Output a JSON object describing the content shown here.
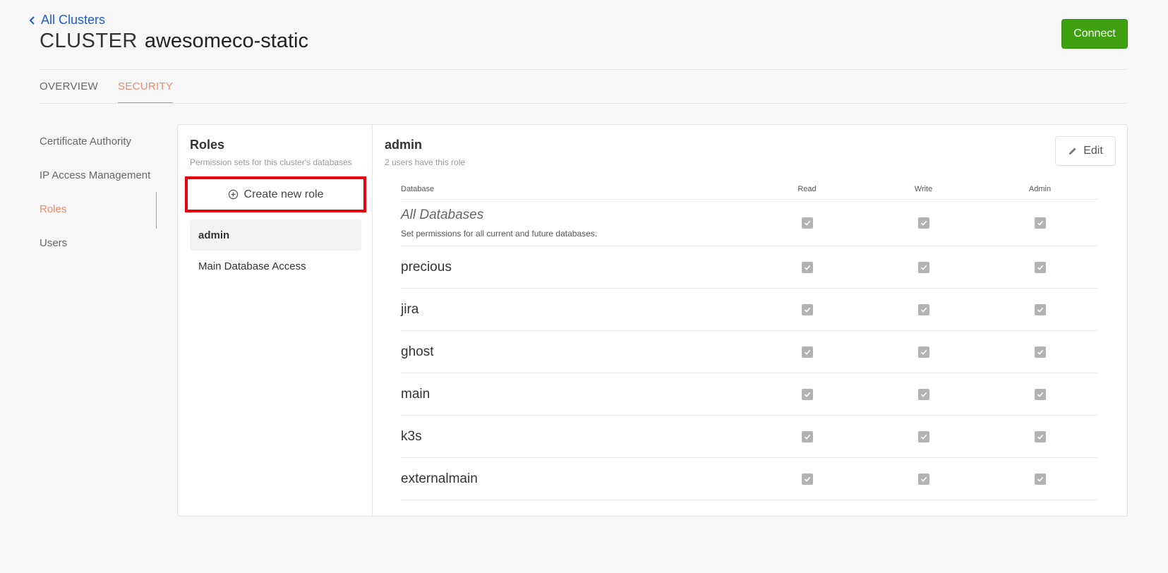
{
  "header": {
    "back_label": "All Clusters",
    "cluster_prefix": "CLUSTER",
    "cluster_name": "awesomeco-static",
    "connect_label": "Connect"
  },
  "tabs": [
    {
      "label": "OVERVIEW",
      "active": false
    },
    {
      "label": "SECURITY",
      "active": true
    }
  ],
  "side_nav": [
    {
      "label": "Certificate Authority",
      "active": false
    },
    {
      "label": "IP Access Management",
      "active": false
    },
    {
      "label": "Roles",
      "active": true
    },
    {
      "label": "Users",
      "active": false
    }
  ],
  "roles_panel": {
    "title": "Roles",
    "subtitle": "Permission sets for this cluster's databases",
    "create_label": "Create new role",
    "roles": [
      {
        "label": "admin",
        "active": true
      },
      {
        "label": "Main Database Access",
        "active": false
      }
    ]
  },
  "detail": {
    "role_name": "admin",
    "user_count_text": "2 users have this role",
    "edit_label": "Edit",
    "columns": [
      "Database",
      "Read",
      "Write",
      "Admin"
    ],
    "rows": [
      {
        "name": "All Databases",
        "description": "Set permissions for all current and future databases.",
        "read": true,
        "write": true,
        "admin": true
      },
      {
        "name": "precious",
        "read": true,
        "write": true,
        "admin": true
      },
      {
        "name": "jira",
        "read": true,
        "write": true,
        "admin": true
      },
      {
        "name": "ghost",
        "read": true,
        "write": true,
        "admin": true
      },
      {
        "name": "main",
        "read": true,
        "write": true,
        "admin": true
      },
      {
        "name": "k3s",
        "read": true,
        "write": true,
        "admin": true
      },
      {
        "name": "externalmain",
        "read": true,
        "write": true,
        "admin": true
      }
    ]
  },
  "colors": {
    "accent": "#ea8a6c",
    "link": "#1f5bd1",
    "connect_bg": "#3fa010",
    "highlight_border": "#e8000e",
    "checkbox": "#b3b3b3"
  }
}
